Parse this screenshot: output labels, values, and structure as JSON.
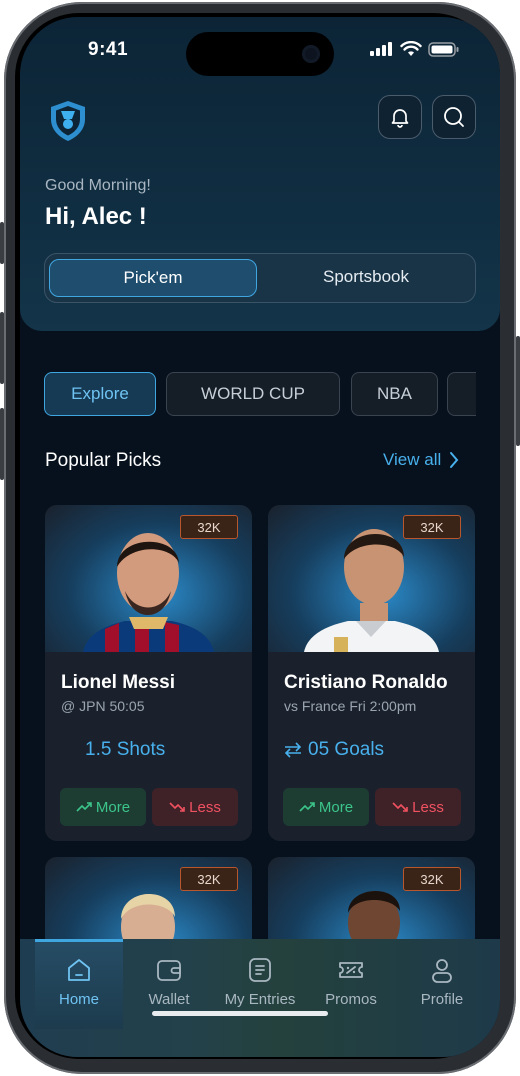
{
  "status_bar": {
    "time": "9:41"
  },
  "header": {
    "greeting": "Good Morning!",
    "user_greeting": "Hi, Alec !",
    "segments": [
      {
        "label": "Pick'em",
        "active": true
      },
      {
        "label": "Sportsbook",
        "active": false
      }
    ]
  },
  "filters": [
    {
      "label": "Explore",
      "active": true
    },
    {
      "label": "WORLD CUP",
      "active": false
    },
    {
      "label": "NBA",
      "active": false
    },
    {
      "label": "",
      "active": false
    }
  ],
  "popular": {
    "title": "Popular Picks",
    "view_all": "View all",
    "cards": [
      {
        "badge": "32K",
        "name": "Lionel Messi",
        "match": "@ JPN 50:05",
        "stat": "1.5 Shots",
        "more": "More",
        "less": "Less"
      },
      {
        "badge": "32K",
        "name": "Cristiano Ronaldo",
        "match": "vs France Fri 2:00pm",
        "stat": "05 Goals",
        "more": "More",
        "less": "Less"
      },
      {
        "badge": "32K"
      },
      {
        "badge": "32K"
      }
    ]
  },
  "nav": [
    {
      "label": "Home",
      "icon": "home-icon",
      "active": true
    },
    {
      "label": "Wallet",
      "icon": "wallet-icon",
      "active": false
    },
    {
      "label": "My Entries",
      "icon": "entries-icon",
      "active": false
    },
    {
      "label": "Promos",
      "icon": "ticket-icon",
      "active": false
    },
    {
      "label": "Profile",
      "icon": "profile-icon",
      "active": false
    }
  ],
  "colors": {
    "accent": "#3fa6e0",
    "more": "#3cc58a",
    "less": "#f05260",
    "background": "#07111d"
  }
}
